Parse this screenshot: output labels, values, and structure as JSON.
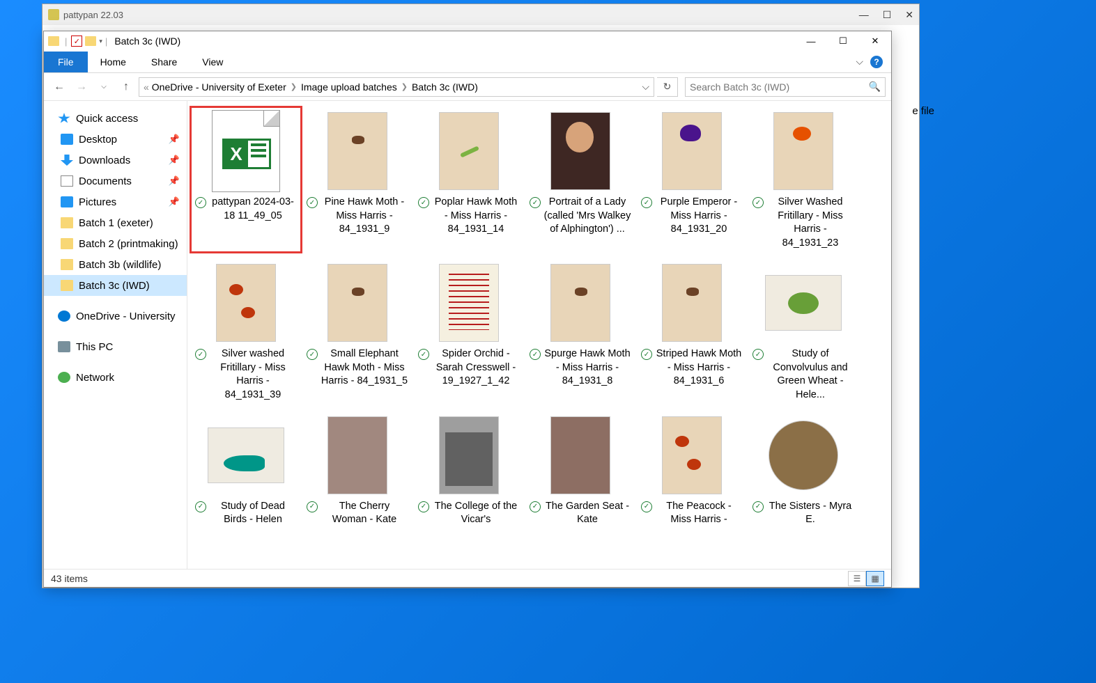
{
  "bg_window": {
    "title": "pattypan 22.03",
    "side_text": "e file"
  },
  "window": {
    "title": "Batch 3c (IWD)"
  },
  "tabs": {
    "file": "File",
    "home": "Home",
    "share": "Share",
    "view": "View"
  },
  "breadcrumb": {
    "prefix": "«",
    "parts": [
      "OneDrive - University of Exeter",
      "Image upload batches",
      "Batch 3c (IWD)"
    ]
  },
  "search": {
    "placeholder": "Search Batch 3c (IWD)"
  },
  "nav": {
    "quick_access": "Quick access",
    "desktop": "Desktop",
    "downloads": "Downloads",
    "documents": "Documents",
    "pictures": "Pictures",
    "batch1": "Batch 1 (exeter)",
    "batch2": "Batch 2 (printmaking)",
    "batch3b": "Batch 3b (wildlife)",
    "batch3c": "Batch 3c (IWD)",
    "onedrive": "OneDrive - University",
    "thispc": "This PC",
    "network": "Network"
  },
  "files": [
    {
      "name": "pattypan 2024-03-18 11_49_05",
      "type": "xls",
      "highlighted": true
    },
    {
      "name": "Pine Hawk Moth - Miss Harris - 84_1931_9",
      "thumb": "t-center-sm"
    },
    {
      "name": "Poplar Hawk Moth - Miss Harris - 84_1931_14",
      "thumb": "t-caterpillar"
    },
    {
      "name": "Portrait of a Lady (called 'Mrs Walkey of Alphington') ...",
      "thumb": "t-portrait"
    },
    {
      "name": "Purple Emperor - Miss Harris - 84_1931_20",
      "thumb": "t-butterfly"
    },
    {
      "name": "Silver Washed Fritillary - Miss Harris - 84_1931_23",
      "thumb": "t-orange"
    },
    {
      "name": "Silver washed Fritillary - Miss Harris - 84_1931_39",
      "thumb": "t-two"
    },
    {
      "name": "Small Elephant Hawk Moth - Miss Harris - 84_1931_5",
      "thumb": "t-center-sm"
    },
    {
      "name": "Spider Orchid - Sarah Cresswell - 19_1927_1_42",
      "thumb": "t-text"
    },
    {
      "name": "Spurge Hawk Moth - Miss Harris - 84_1931_8",
      "thumb": "t-center-sm"
    },
    {
      "name": "Striped Hawk Moth - Miss Harris - 84_1931_6",
      "thumb": "t-center-sm"
    },
    {
      "name": "Study of Convolvulus and Green Wheat - Hele...",
      "thumb": "t-flower",
      "wide": true
    },
    {
      "name": "Study of Dead Birds - Helen",
      "thumb": "t-bird",
      "wide": true
    },
    {
      "name": "The Cherry Woman - Kate",
      "thumb": "t-people"
    },
    {
      "name": "The College of the Vicar's",
      "thumb": "t-building"
    },
    {
      "name": "The Garden Seat - Kate",
      "thumb": "t-garden"
    },
    {
      "name": "The Peacock - Miss Harris -",
      "thumb": "t-two"
    },
    {
      "name": "The Sisters - Myra E.",
      "thumb": "t-people",
      "round": true
    }
  ],
  "status": {
    "count": "43 items"
  }
}
